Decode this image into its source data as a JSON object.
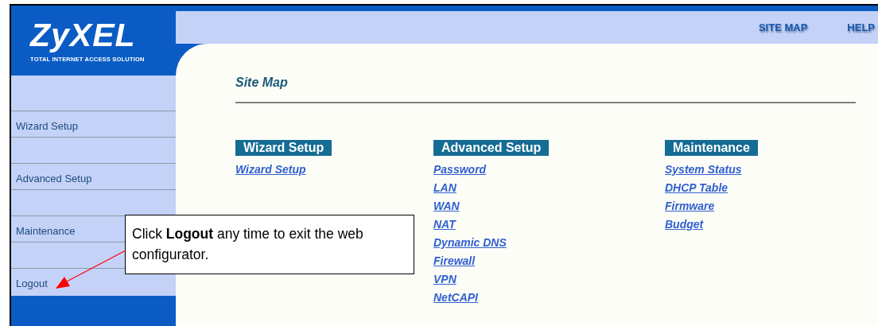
{
  "logo": {
    "name": "ZyXEL",
    "tagline": "TOTAL INTERNET ACCESS SOLUTION"
  },
  "header_links": [
    "SITE MAP",
    "HELP"
  ],
  "sidebar": {
    "items": [
      {
        "label": "Wizard Setup"
      },
      {
        "label": "Advanced Setup"
      },
      {
        "label": "Maintenance"
      },
      {
        "label": "Logout"
      }
    ]
  },
  "page_title": "Site Map",
  "sections": [
    {
      "heading": "Wizard Setup",
      "links": [
        "Wizard Setup"
      ]
    },
    {
      "heading": "Advanced Setup",
      "links": [
        "Password",
        "LAN",
        "WAN",
        "NAT",
        "Dynamic DNS",
        "Firewall",
        "VPN",
        "NetCAPI"
      ]
    },
    {
      "heading": "Maintenance",
      "links": [
        "System Status",
        "DHCP Table",
        "Firmware",
        "Budget"
      ]
    }
  ],
  "callout": {
    "text": "Click **Logout** any time to exit the web configurator."
  }
}
